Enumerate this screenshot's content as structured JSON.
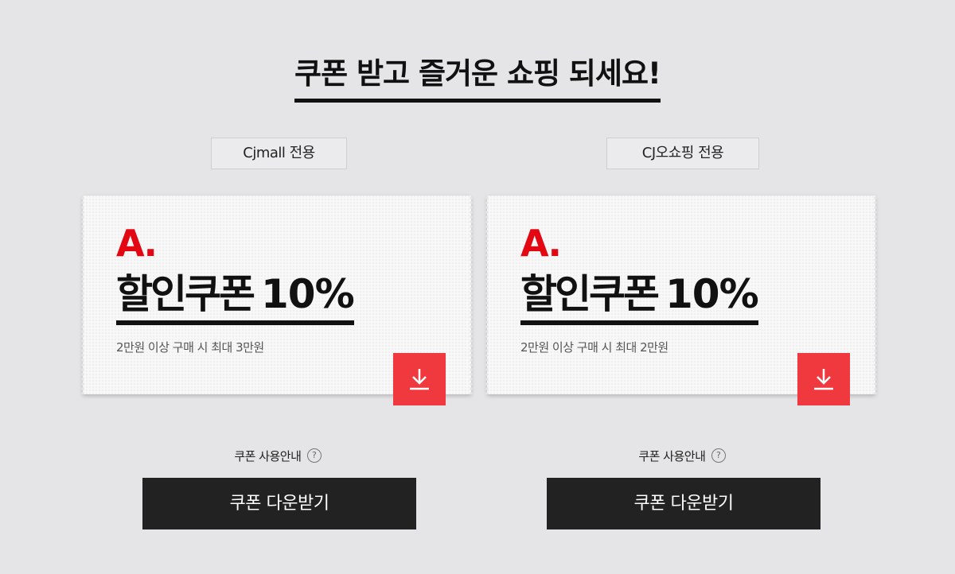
{
  "page": {
    "title": "쿠폰 받고 즐거운 쇼핑 되세요!"
  },
  "coupons": [
    {
      "tag": "Cjmall 전용",
      "logo": "A.",
      "headline": "할인쿠폰",
      "percent": "10%",
      "condition": "2만원 이상 구매 시 최대 3만원",
      "download_icon": "download-icon",
      "guide_label": "쿠폰 사용안내",
      "guide_icon": "?",
      "button_label": "쿠폰 다운받기"
    },
    {
      "tag": "CJ오쇼핑 전용",
      "logo": "A.",
      "headline": "할인쿠폰",
      "percent": "10%",
      "condition": "2만원 이상 구매 시 최대 2만원",
      "download_icon": "download-icon",
      "guide_label": "쿠폰 사용안내",
      "guide_icon": "?",
      "button_label": "쿠폰 다운받기"
    }
  ],
  "colors": {
    "accent": "#e30613",
    "download": "#f0383f",
    "button": "#222222",
    "background": "#e5e5e7"
  }
}
